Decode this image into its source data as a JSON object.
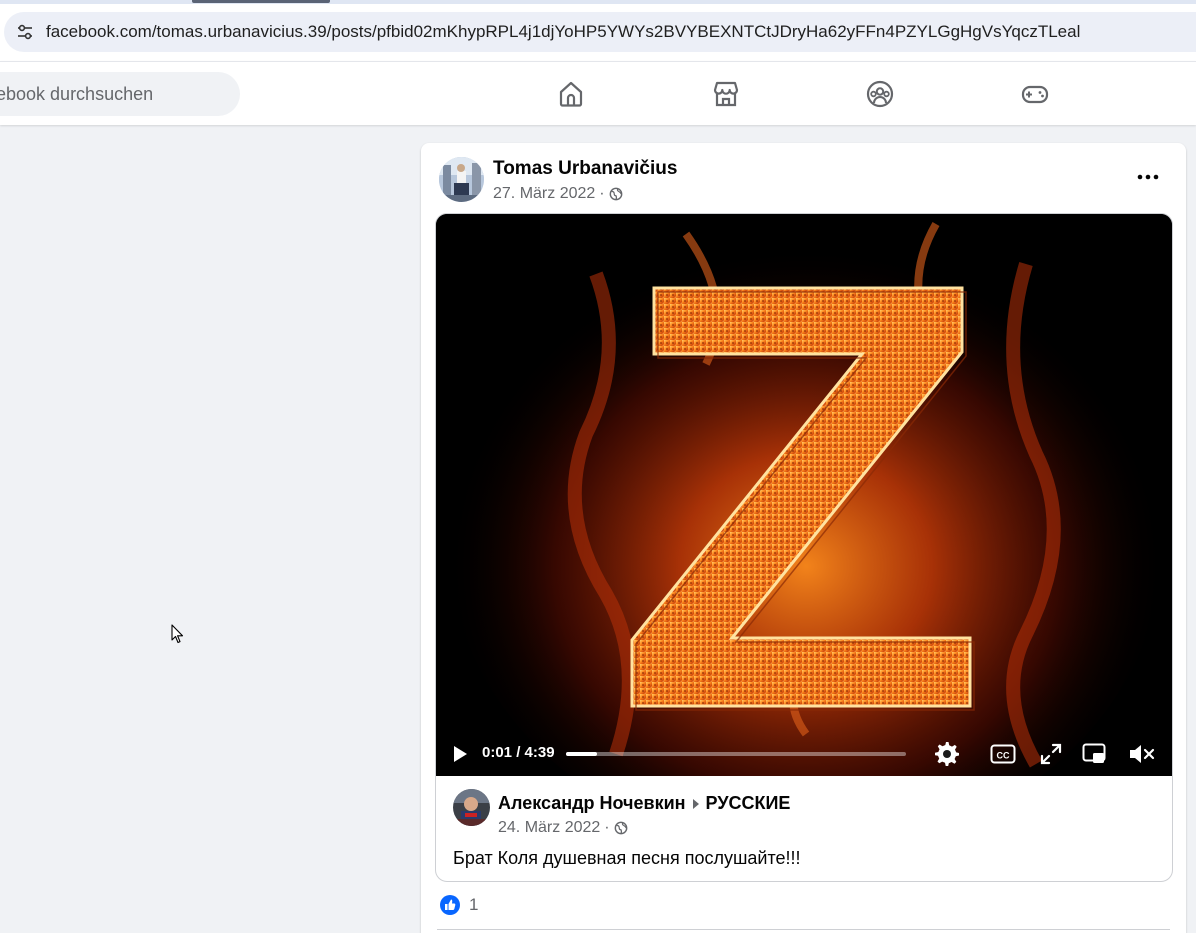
{
  "browser": {
    "url": "facebook.com/tomas.urbanavicius.39/posts/pfbid02mKhypRPL4j1djYoHP5YWYs2BVYBEXNTCtJDryHa62yFFn4PZYLGgHgVsYqczTLeal",
    "site_info_icon": "tune-icon"
  },
  "header": {
    "search_text": "ebook durchsuchen",
    "nav": [
      {
        "icon": "home-icon"
      },
      {
        "icon": "marketplace-icon"
      },
      {
        "icon": "groups-icon"
      },
      {
        "icon": "gaming-icon"
      }
    ]
  },
  "post": {
    "author": "Tomas Urbanavičius",
    "date": "27. März 2022",
    "separator": "·",
    "privacy_icon": "globe-icon",
    "more_icon": "more-icon",
    "shared": {
      "video": {
        "time": "0:01 / 4:39",
        "progress": 0.09,
        "overlay_letter": "Z",
        "controls": [
          "play-icon",
          "settings-icon",
          "captions-icon",
          "fullscreen-icon",
          "picture-in-picture-icon",
          "mute-icon"
        ]
      },
      "author": "Александр Ночевкин",
      "arrow_icon": "caret-right-icon",
      "group": "РУССКИЕ",
      "date": "24. März 2022",
      "separator": "·",
      "text": "Брат Коля душевная песня послушайте!!!"
    },
    "reactions": {
      "icon": "like-icon",
      "count": "1"
    }
  },
  "colors": {
    "fb_blue": "#0866ff",
    "page_bg": "#f0f2f5",
    "secondary_text": "#65676b"
  }
}
